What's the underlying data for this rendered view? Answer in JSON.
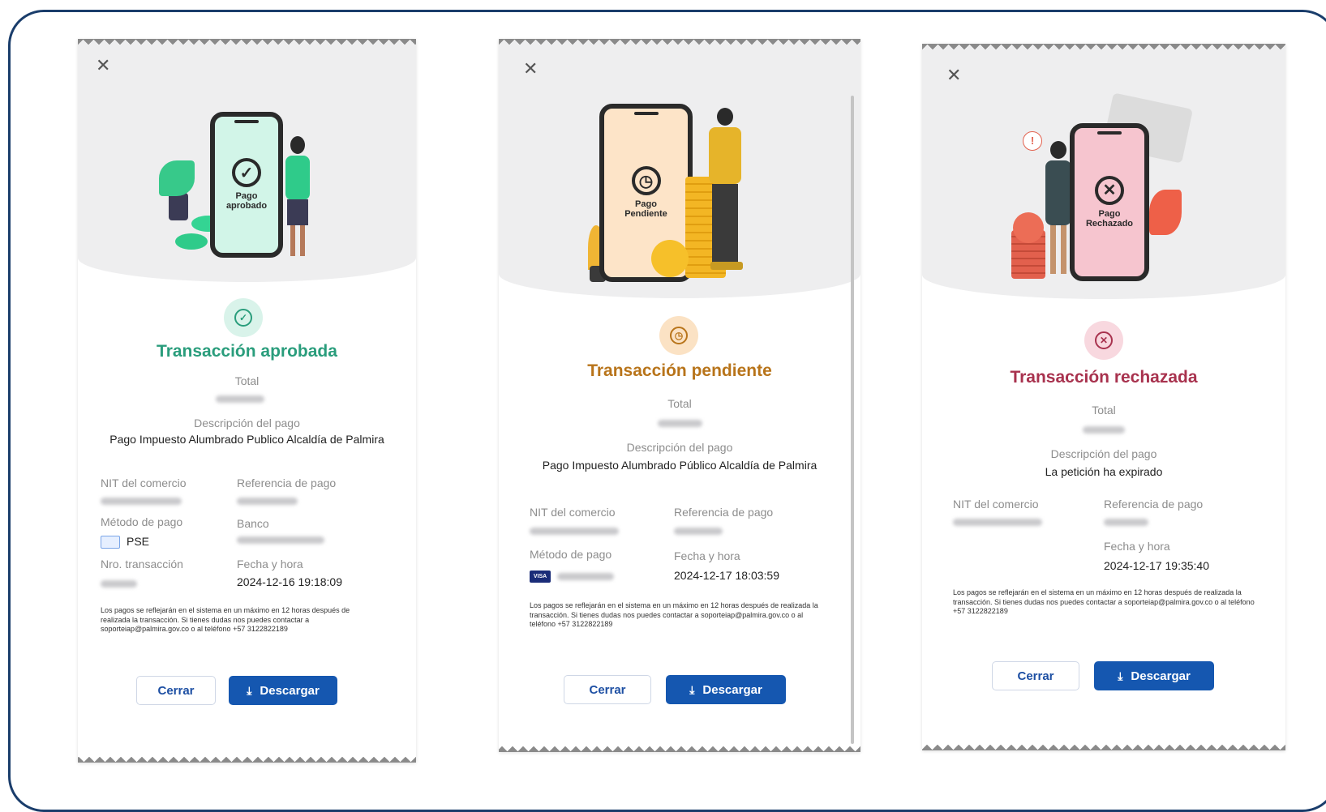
{
  "colors": {
    "approved": "#2a9d7c",
    "pending": "#b8741a",
    "rejected": "#a8324e",
    "primary_button": "#1557b0",
    "frame": "#1a3d6b"
  },
  "receipts": [
    {
      "close_icon": "close-icon",
      "phone_text": "Pago aprobado",
      "title": "Transacción aprobada",
      "total_label": "Total",
      "desc_label": "Descripción del pago",
      "desc_value": "Pago Impuesto Alumbrado Publico Alcaldía de Palmira",
      "nit_label": "NIT del comercio",
      "ref_label": "Referencia de pago",
      "method_label": "Método de pago",
      "method_value": "PSE",
      "bank_label": "Banco",
      "txn_label": "Nro. transacción",
      "date_label": "Fecha y hora",
      "date_value": "2024-12-16 19:18:09",
      "note": "Los pagos se reflejarán en el sistema en un máximo en 12 horas después de realizada la transacción. Si tienes dudas nos puedes contactar a soporteiap@palmira.gov.co o al teléfono +57 3122822189",
      "close_btn": "Cerrar",
      "download_btn": "Descargar"
    },
    {
      "close_icon": "close-icon",
      "phone_text": "Pago Pendiente",
      "title": "Transacción pendiente",
      "total_label": "Total",
      "desc_label": "Descripción del pago",
      "desc_value": "Pago Impuesto Alumbrado Público Alcaldía de Palmira",
      "nit_label": "NIT del comercio",
      "ref_label": "Referencia de pago",
      "method_label": "Método de pago",
      "date_label": "Fecha y hora",
      "date_value": "2024-12-17 18:03:59",
      "card_brand": "VISA",
      "note": "Los pagos se reflejarán en el sistema en un máximo en 12 horas después de realizada la transacción. Si tienes dudas nos puedes contactar a soporteiap@palmira.gov.co o al teléfono +57 3122822189",
      "close_btn": "Cerrar",
      "download_btn": "Descargar"
    },
    {
      "close_icon": "close-icon",
      "phone_text": "Pago Rechazado",
      "title": "Transacción rechazada",
      "total_label": "Total",
      "desc_label": "Descripción del pago",
      "desc_value": "La petición ha expirado",
      "nit_label": "NIT del comercio",
      "ref_label": "Referencia de pago",
      "date_label": "Fecha y hora",
      "date_value": "2024-12-17 19:35:40",
      "note": "Los pagos se reflejarán en el sistema en un máximo en 12 horas después de realizada la transacción. Si tienes dudas nos puedes contactar a soporteiap@palmira.gov.co o al teléfono +57 3122822189",
      "close_btn": "Cerrar",
      "download_btn": "Descargar"
    }
  ]
}
